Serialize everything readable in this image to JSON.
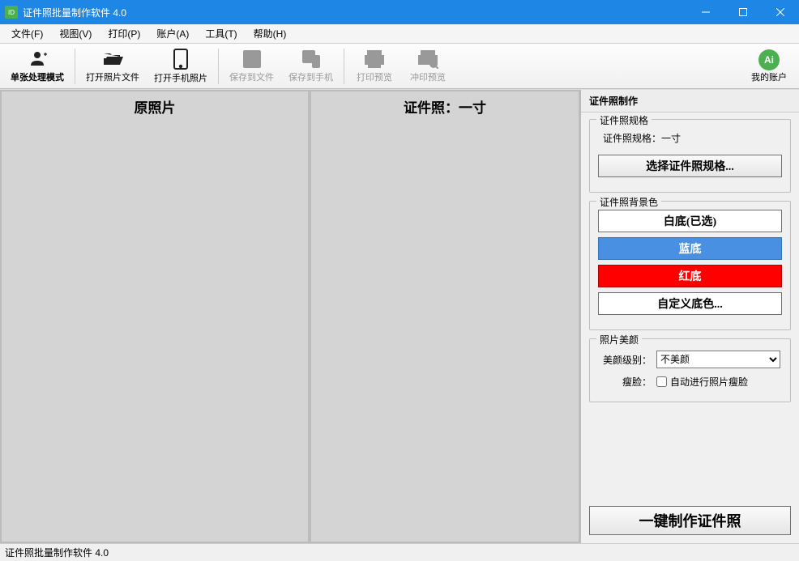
{
  "window": {
    "title": "证件照批量制作软件 4.0"
  },
  "menubar": {
    "items": [
      "文件(F)",
      "视图(V)",
      "打印(P)",
      "账户(A)",
      "工具(T)",
      "帮助(H)"
    ]
  },
  "toolbar": {
    "single_mode": "单张处理模式",
    "open_photo": "打开照片文件",
    "open_phone": "打开手机照片",
    "save_file": "保存到文件",
    "save_phone": "保存到手机",
    "print_preview": "打印预览",
    "develop_preview": "冲印预览",
    "my_account": "我的账户",
    "ai_label": "Ai"
  },
  "panels": {
    "left_title": "原照片",
    "middle_title": "证件照：一寸"
  },
  "side": {
    "title": "证件照制作",
    "spec": {
      "group_title": "证件照规格",
      "label_prefix": "证件照规格：",
      "current": "一寸",
      "choose_btn": "选择证件照规格..."
    },
    "bg": {
      "group_title": "证件照背景色",
      "white": "白底(已选)",
      "blue": "蓝底",
      "red": "红底",
      "custom": "自定义底色..."
    },
    "beauty": {
      "group_title": "照片美颜",
      "level_label": "美颜级别：",
      "level_value": "不美颜",
      "slim_label": "瘦脸：",
      "slim_checkbox_label": "自动进行照片瘦脸",
      "slim_checked": false
    },
    "make_btn": "一键制作证件照"
  },
  "statusbar": {
    "text": "证件照批量制作软件 4.0"
  }
}
